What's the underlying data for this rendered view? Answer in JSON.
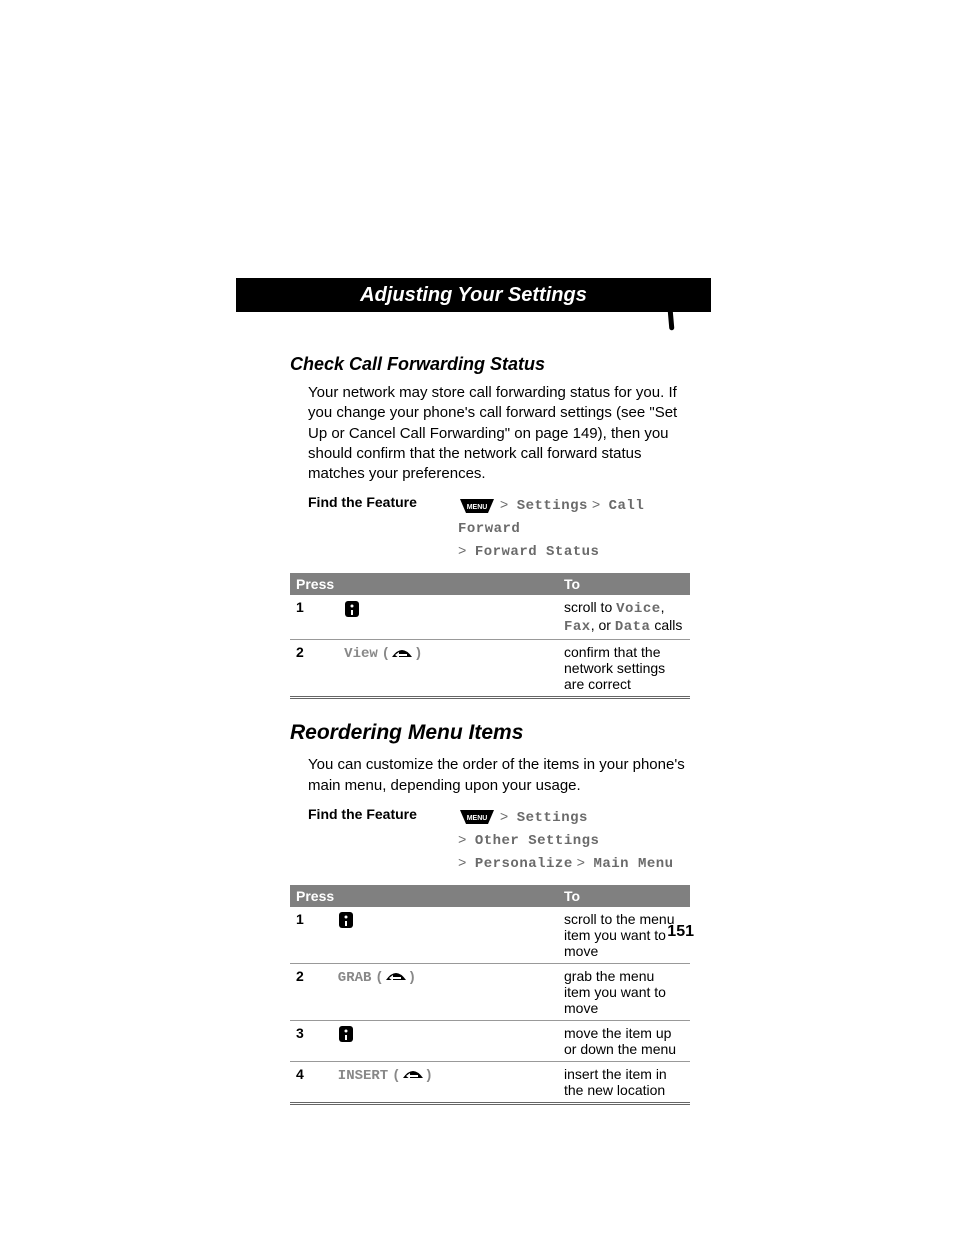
{
  "page_title": "Adjusting Your Settings",
  "page_number": "151",
  "section1": {
    "heading": "Check Call Forwarding Status",
    "para": "Your network may store call forwarding status for you. If you change your phone's call forward settings (see \"Set Up or Cancel Call Forwarding\" on page 149), then you should confirm that the network call forward status matches your preferences.",
    "ftf_label": "Find the Feature",
    "path_items": [
      "Settings",
      "Call Forward",
      "Forward Status"
    ],
    "table": {
      "hdr_press": "Press",
      "hdr_to": "To",
      "rows": [
        {
          "n": "1",
          "press_type": "scroll",
          "to_pre": "scroll to ",
          "to_m1": "Voice",
          "to_mid1": ", ",
          "to_m2": "Fax",
          "to_mid2": ", or ",
          "to_m3": "Data",
          "to_post": " calls"
        },
        {
          "n": "2",
          "press_type": "softkey",
          "press_label": "View",
          "to": "confirm that the network settings are correct"
        }
      ]
    }
  },
  "section2": {
    "heading": "Reordering Menu Items",
    "para": "You can customize the order of the items in your phone's main menu, depending upon your usage.",
    "ftf_label": "Find the Feature",
    "path_items": [
      "Settings",
      "Other Settings",
      "Personalize",
      "Main Menu"
    ],
    "table": {
      "hdr_press": "Press",
      "hdr_to": "To",
      "rows": [
        {
          "n": "1",
          "press_type": "scroll",
          "to": "scroll to the menu item you want to move"
        },
        {
          "n": "2",
          "press_type": "softkey",
          "press_label": "GRAB",
          "to": "grab the menu item you want to move"
        },
        {
          "n": "3",
          "press_type": "scroll",
          "to": "move the item up or down the menu"
        },
        {
          "n": "4",
          "press_type": "softkey",
          "press_label": "INSERT",
          "to": "insert the item in the new location"
        }
      ]
    }
  }
}
